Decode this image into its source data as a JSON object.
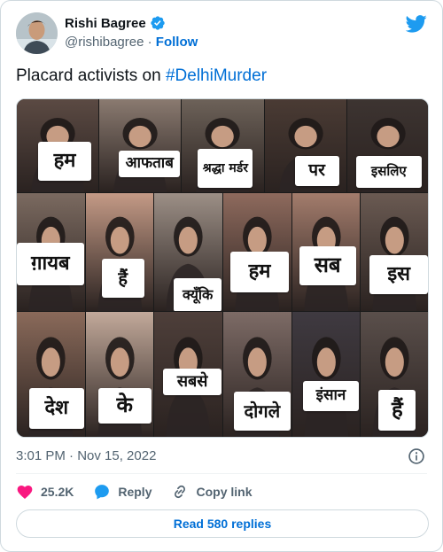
{
  "author": {
    "name": "Rishi Bagree",
    "handle": "@rishibagree",
    "separator": "·",
    "follow_label": "Follow"
  },
  "tweet": {
    "text_prefix": "Placard activists on ",
    "hashtag": "#DelhiMurder",
    "timestamp": "3:01 PM · Nov 15, 2022"
  },
  "media": {
    "placards": [
      [
        "हम",
        "आफताब",
        "श्रद्धा मर्डर",
        "पर",
        "इसलिए"
      ],
      [
        "ग़ायब",
        "हैं",
        "क्यूँकि",
        "हम",
        "सब",
        "इस"
      ],
      [
        "देश",
        "के",
        "सबसे",
        "दोगले",
        "इंसान",
        "हैं"
      ]
    ]
  },
  "actions": {
    "likes_count": "25.2K",
    "reply_label": "Reply",
    "copy_label": "Copy link",
    "read_replies_label": "Read 580 replies"
  },
  "colors": {
    "accent": "#1d9bf0",
    "link": "#006fd6",
    "heart": "#f91880",
    "muted": "#536471"
  },
  "icons": [
    "verified-badge-icon",
    "twitter-bird-icon",
    "info-icon",
    "heart-icon",
    "reply-bubble-icon",
    "link-icon"
  ]
}
